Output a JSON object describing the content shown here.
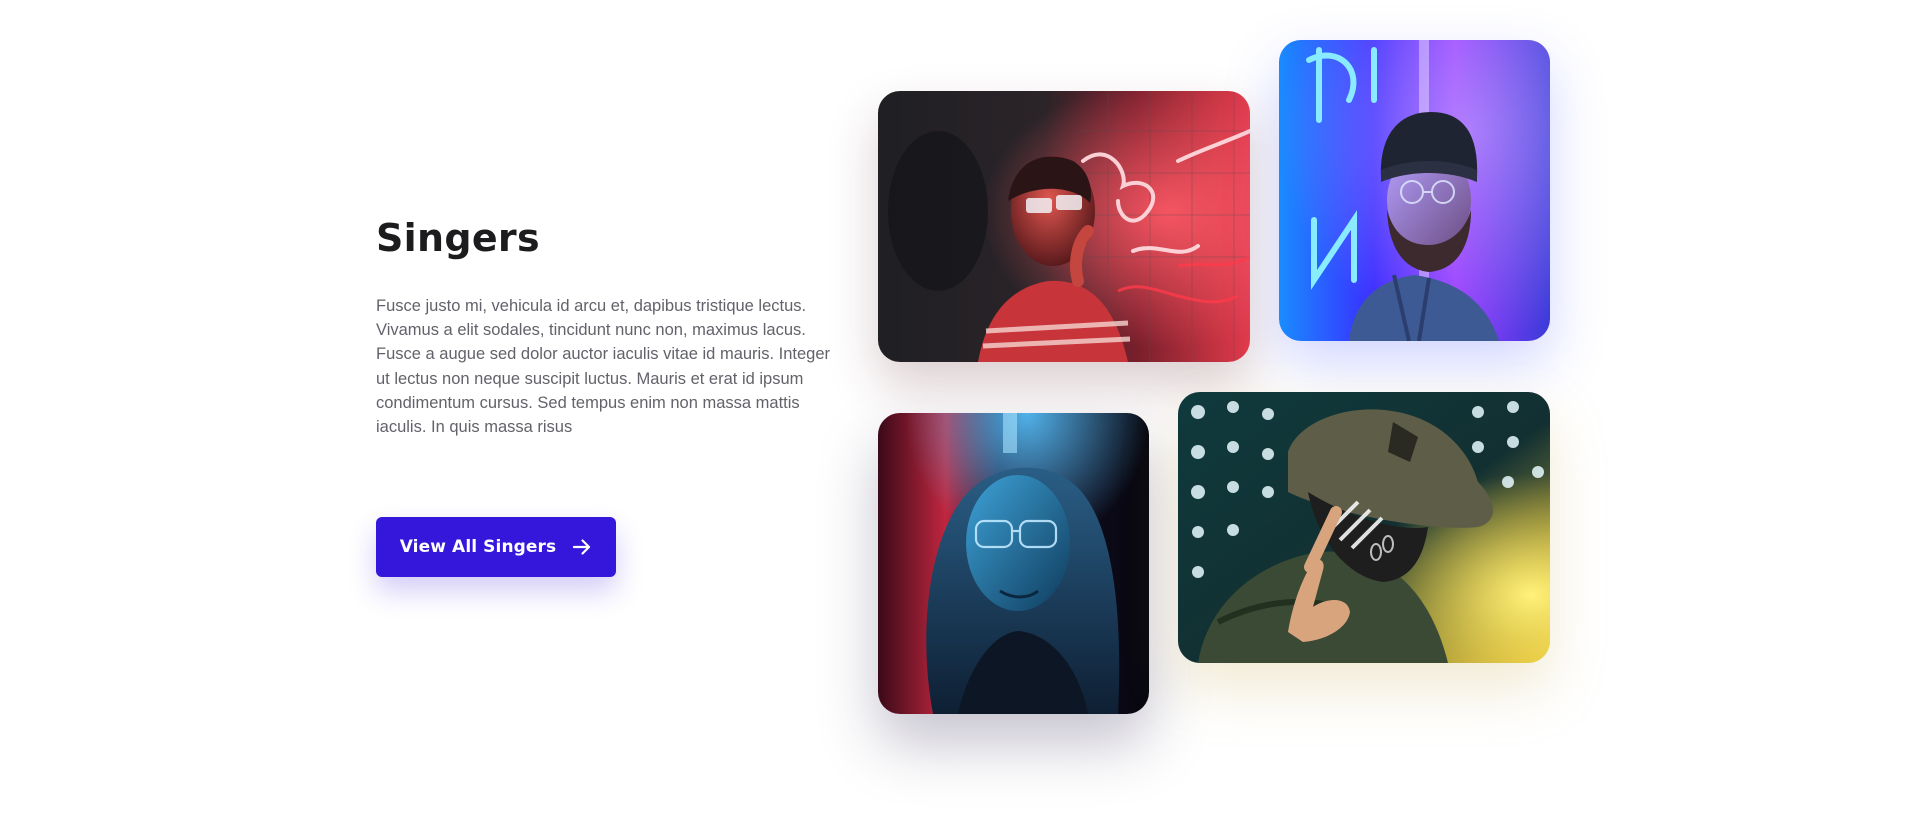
{
  "section": {
    "title": "Singers",
    "description": "Fusce justo mi, vehicula id arcu et, dapibus tristique lectus. Vivamus a elit sodales, tincidunt nunc non, maximus lacus. Fusce a augue sed dolor auctor iaculis vitae id mauris. Integer ut lectus non neque suscipit luctus. Mauris et erat id ipsum condimentum cursus. Sed tempus enim non massa mattis iaculis. In quis massa risus",
    "cta_label": "View All Singers",
    "cta_icon": "arrow-right-icon"
  },
  "colors": {
    "accent": "#3517dc",
    "title": "#1c1c1e",
    "body_text": "#62626a"
  },
  "gallery": [
    {
      "name": "photo-woman-neon-glasses",
      "palette": [
        "#b31c2a",
        "#ff4a5a",
        "#1b1b21"
      ]
    },
    {
      "name": "photo-bearded-man-beanie",
      "palette": [
        "#2a3bff",
        "#35c8ff",
        "#c23bff"
      ]
    },
    {
      "name": "photo-woman-blue-light",
      "palette": [
        "#1a6fa8",
        "#c02648",
        "#0b0b16"
      ]
    },
    {
      "name": "photo-masked-man-bucket-hat",
      "palette": [
        "#143a3a",
        "#ffe44a",
        "#6c6c54"
      ]
    }
  ]
}
